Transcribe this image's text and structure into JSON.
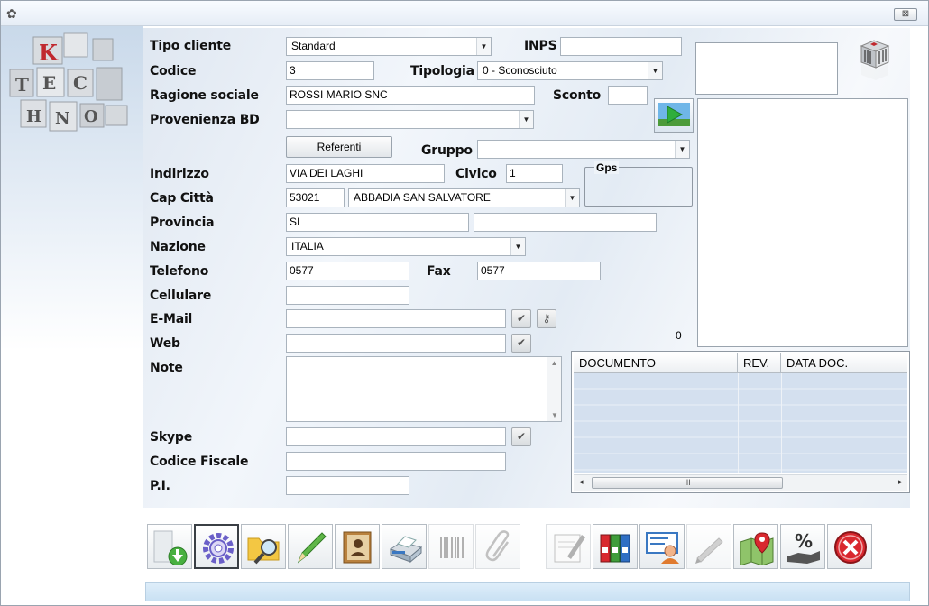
{
  "window": {
    "close_label": "⊠"
  },
  "logo": {
    "letters": [
      "K",
      "T",
      "E",
      "C",
      "H",
      "N",
      "O"
    ]
  },
  "form": {
    "tipo_cliente": {
      "label": "Tipo cliente",
      "value": "Standard"
    },
    "inps": {
      "label": "INPS",
      "value": ""
    },
    "codice": {
      "label": "Codice",
      "value": "3"
    },
    "tipologia": {
      "label": "Tipologia",
      "value": "0 - Sconosciuto"
    },
    "ragione_sociale": {
      "label": "Ragione sociale",
      "value": "ROSSI MARIO SNC"
    },
    "sconto": {
      "label": "Sconto",
      "value": ""
    },
    "provenienza_bd": {
      "label": "Provenienza BD",
      "value": ""
    },
    "referenti_button": "Referenti",
    "gruppo": {
      "label": "Gruppo",
      "value": ""
    },
    "indirizzo": {
      "label": "Indirizzo",
      "value": "VIA DEI LAGHI"
    },
    "civico": {
      "label": "Civico",
      "value": "1"
    },
    "gps": {
      "label": "Gps",
      "value": ""
    },
    "cap_citta": {
      "label": "Cap Città",
      "cap": "53021",
      "citta": "ABBADIA SAN SALVATORE"
    },
    "provincia": {
      "label": "Provincia",
      "value": "SI",
      "extra": ""
    },
    "nazione": {
      "label": "Nazione",
      "value": "ITALIA"
    },
    "telefono": {
      "label": "Telefono",
      "value": "0577"
    },
    "fax": {
      "label": "Fax",
      "value": "0577"
    },
    "cellulare": {
      "label": "Cellulare",
      "value": ""
    },
    "email": {
      "label": "E-Mail",
      "value": ""
    },
    "web": {
      "label": "Web",
      "value": ""
    },
    "note": {
      "label": "Note",
      "value": ""
    },
    "skype": {
      "label": "Skype",
      "value": ""
    },
    "codice_fiscale": {
      "label": "Codice Fiscale",
      "value": ""
    },
    "pi": {
      "label": "P.I.",
      "value": ""
    }
  },
  "side": {
    "counter": "0"
  },
  "documents": {
    "columns": [
      "DOCUMENTO",
      "REV.",
      "DATA DOC."
    ],
    "scroll_thumb": "III"
  },
  "toolbar": {
    "buttons": [
      {
        "name": "download",
        "icon": "green-down-arrow"
      },
      {
        "name": "settings",
        "icon": "gear"
      },
      {
        "name": "search-folder",
        "icon": "folder-magnifier"
      },
      {
        "name": "edit",
        "icon": "pencil"
      },
      {
        "name": "address-book",
        "icon": "contacts-book"
      },
      {
        "name": "print",
        "icon": "printer"
      },
      {
        "name": "barcode",
        "icon": "barcode"
      },
      {
        "name": "attachment",
        "icon": "paperclip"
      },
      {
        "name": "signature",
        "icon": "pen-document"
      },
      {
        "name": "binders",
        "icon": "binders"
      },
      {
        "name": "user-card",
        "icon": "user-card"
      },
      {
        "name": "pen-disabled",
        "icon": "pen"
      },
      {
        "name": "map",
        "icon": "map-pin"
      },
      {
        "name": "discount",
        "icon": "percent-hand"
      },
      {
        "name": "close",
        "icon": "red-close"
      }
    ]
  },
  "colors": {
    "accent": "#3a78c2",
    "logo_red": "#c0282e",
    "close_red": "#d9282f"
  }
}
